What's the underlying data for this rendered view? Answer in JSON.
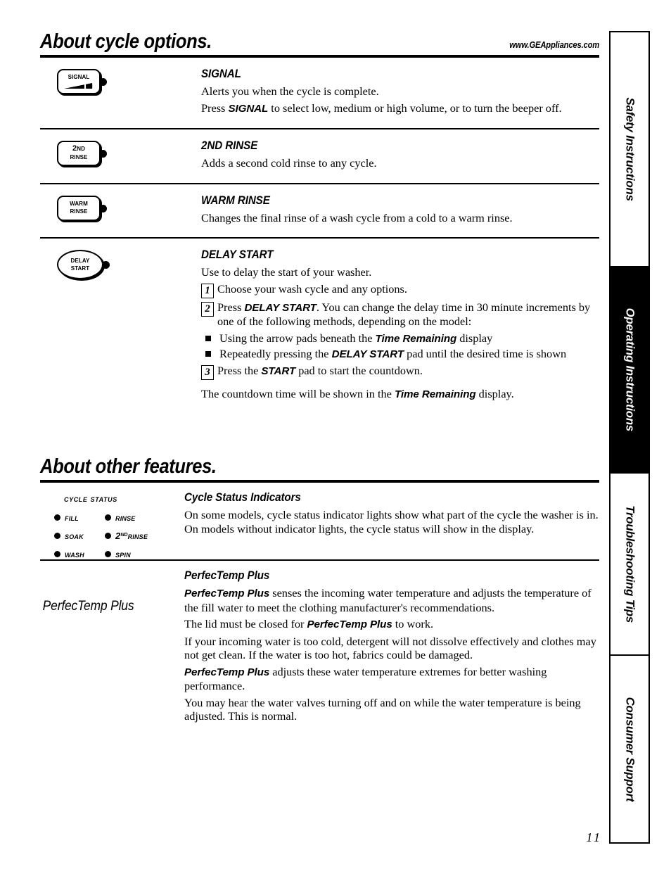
{
  "header": {
    "title": "About cycle options.",
    "url": "www.GEAppliances.com"
  },
  "cycle_options": [
    {
      "pad_label_line1": "SIGNAL",
      "pad_label_line2": "",
      "pad_shape": "rounded-rect",
      "pad_icon": "volume-wedge-icon",
      "title": "SIGNAL",
      "paragraphs": [
        "Alerts you when the cycle is complete.",
        "Press SIGNAL to select low, medium or high volume, or to turn the beeper off."
      ],
      "p2_prefix": "Press ",
      "p2_keyword": "SIGNAL",
      "p2_suffix": " to select low, medium or high volume, or to turn the beeper off."
    },
    {
      "pad_label_line1": "2ND",
      "pad_label_line2": "RINSE",
      "pad_shape": "rounded-rect",
      "title": "2ND RINSE",
      "paragraphs": [
        "Adds a second cold rinse to any cycle."
      ]
    },
    {
      "pad_label_line1": "WARM",
      "pad_label_line2": "RINSE",
      "pad_shape": "rounded-rect",
      "title": "WARM RINSE",
      "paragraphs": [
        "Changes the final rinse of a wash cycle from a cold to a warm rinse."
      ]
    },
    {
      "pad_label_line1": "DELAY",
      "pad_label_line2": "START",
      "pad_shape": "oval",
      "title": "DELAY START",
      "intro": "Use to delay the start of your washer.",
      "steps": [
        {
          "num": "1",
          "text": "Choose your wash cycle and any options."
        },
        {
          "num": "2",
          "prefix": "Press ",
          "keyword": "DELAY START",
          "suffix": ". You can change the delay time in 30 minute increments by one of the following methods, depending on the model:"
        },
        {
          "num": "3",
          "prefix": "Press the ",
          "keyword": "START",
          "suffix": " pad to start the countdown."
        }
      ],
      "bullets": [
        {
          "prefix": "Using the arrow pads beneath the ",
          "keyword": "Time Remaining",
          "suffix": " display"
        },
        {
          "prefix": "Repeatedly pressing the ",
          "keyword": "DELAY START",
          "suffix": " pad until the desired time is shown"
        }
      ],
      "closing_prefix": "The countdown time will be shown in the ",
      "closing_keyword": "Time Remaining",
      "closing_suffix": " display."
    }
  ],
  "other_features": {
    "title": "About other features.",
    "cycle_status": {
      "panel_title": "CYCLE STATUS",
      "indicators": [
        "FILL",
        "RINSE",
        "SOAK",
        "2ND RINSE",
        "WASH",
        "SPIN"
      ],
      "indicator_2nd_rinse": {
        "number": "2",
        "sup": "ND",
        "word": "RINSE"
      },
      "heading": "Cycle Status Indicators",
      "body": "On some models, cycle status indicator lights show what part of the cycle the washer is in. On models without indicator lights, the cycle status will show in the display."
    },
    "perfectemp": {
      "side_label": "PerfecTemp Plus",
      "heading": "PerfecTemp Plus",
      "p1_keyword": "PerfecTemp Plus",
      "p1_suffix": " senses the incoming water temperature and adjusts the temperature of the fill water to meet the clothing manufacturer's recommendations.",
      "p2_prefix": "The lid must be closed for ",
      "p2_keyword": "PerfecTemp Plus",
      "p2_suffix": " to work.",
      "p3": "If your incoming water is too cold, detergent will not dissolve effectively and clothes may not get clean. If the water is too hot, fabrics could be damaged.",
      "p4_keyword": "PerfecTemp Plus",
      "p4_suffix": " adjusts these water temperature extremes for better washing performance.",
      "p5": "You may hear the water valves turning off and on while the water temperature is being adjusted. This is normal."
    }
  },
  "tabs": [
    {
      "label": "Safety Instructions",
      "active": false
    },
    {
      "label": "Operating Instructions",
      "active": true
    },
    {
      "label": "Troubleshooting Tips",
      "active": false
    },
    {
      "label": "Consumer Support",
      "active": false
    }
  ],
  "page_number": "11"
}
